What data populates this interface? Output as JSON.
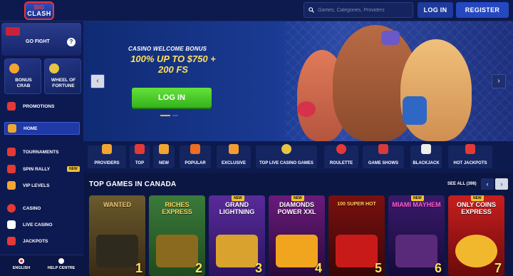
{
  "header": {
    "logo_top": "BIG",
    "logo_bottom": "CLASH",
    "search_placeholder": "Games, Categories, Providers",
    "login_label": "LOG IN",
    "register_label": "REGISTER"
  },
  "sidebar": {
    "go_fight": "GO FIGHT",
    "help_mark": "?",
    "tiles": [
      {
        "label": "BONUS CRAB"
      },
      {
        "label": "WHEEL OF FORTUNE"
      }
    ],
    "items": [
      {
        "label": "PROMOTIONS",
        "icon": "megaphone-icon"
      },
      {
        "label": "HOME",
        "icon": "home-icon",
        "active": true
      },
      {
        "label": "TOURNAMENTS",
        "icon": "trophy-icon"
      },
      {
        "label": "SPIN RALLY",
        "icon": "flag-icon",
        "badge": "NEW"
      },
      {
        "label": "VIP LEVELS",
        "icon": "vip-icon"
      },
      {
        "label": "CASINO",
        "icon": "chip-icon"
      },
      {
        "label": "LIVE CASINO",
        "icon": "dice-icon"
      },
      {
        "label": "JACKPOTS",
        "icon": "sevens-icon"
      }
    ],
    "bottom": {
      "language": "ENGLISH",
      "help": "HELP CENTRE"
    }
  },
  "hero": {
    "subtitle": "CASINO WELCOME BONUS",
    "headline": "100% UP TO $750 + 200 FS",
    "login_button": "LOG IN",
    "prev_arrow": "‹",
    "next_arrow": "›"
  },
  "categories": [
    {
      "label": "PROVIDERS",
      "color": "#f2a531"
    },
    {
      "label": "TOP",
      "color": "#e53935"
    },
    {
      "label": "NEW",
      "color": "#f2a531"
    },
    {
      "label": "POPULAR",
      "color": "#ef6c23"
    },
    {
      "label": "EXCLUSIVE",
      "color": "#f39c32"
    },
    {
      "label": "TOP LIVE CASINO GAMES",
      "color": "#e7c443"
    },
    {
      "label": "ROULETTE",
      "color": "#e53935"
    },
    {
      "label": "GAME SHOWS",
      "color": "#d63a3a"
    },
    {
      "label": "BLACKJACK",
      "color": "#eeeeee"
    },
    {
      "label": "HOT JACKPOTS",
      "color": "#e53935"
    }
  ],
  "top_games": {
    "title": "TOP GAMES IN CANADA",
    "see_all": "SEE ALL (398)",
    "prev": "‹",
    "next": "›",
    "games": [
      {
        "name": "WANTED",
        "rank": "1",
        "new": ""
      },
      {
        "name": "RICHES EXPRESS",
        "rank": "2",
        "new": ""
      },
      {
        "name": "GRAND LIGHTNING",
        "rank": "3",
        "new": "NEW"
      },
      {
        "name": "DIAMONDS POWER XXL",
        "rank": "4",
        "new": "NEW"
      },
      {
        "name": "100 SUPER HOT",
        "rank": "5",
        "new": ""
      },
      {
        "name": "MIAMI MAYHEM",
        "rank": "6",
        "new": "NEW"
      },
      {
        "name": "ONLY COINS EXPRESS",
        "rank": "7",
        "new": "NEW"
      }
    ]
  }
}
